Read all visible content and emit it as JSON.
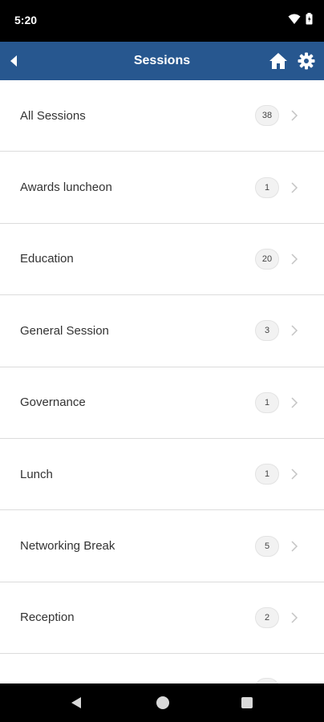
{
  "status_bar": {
    "time": "5:20",
    "wifi_icon": "wifi-icon",
    "battery_icon": "battery-icon"
  },
  "app_bar": {
    "title": "Sessions",
    "back_icon": "back-arrow-icon",
    "home_icon": "home-icon",
    "settings_icon": "gear-icon",
    "background": "#27578f"
  },
  "sessions": [
    {
      "label": "All Sessions",
      "count": "38"
    },
    {
      "label": "Awards luncheon",
      "count": "1"
    },
    {
      "label": "Education",
      "count": "20"
    },
    {
      "label": "General Session",
      "count": "3"
    },
    {
      "label": "Governance",
      "count": "1"
    },
    {
      "label": "Lunch",
      "count": "1"
    },
    {
      "label": "Networking Break",
      "count": "5"
    },
    {
      "label": "Reception",
      "count": "2"
    },
    {
      "label": "",
      "count": ""
    }
  ],
  "nav_bar": {
    "back_icon": "nav-back-icon",
    "home_icon": "nav-home-icon",
    "recents_icon": "nav-recents-icon"
  }
}
